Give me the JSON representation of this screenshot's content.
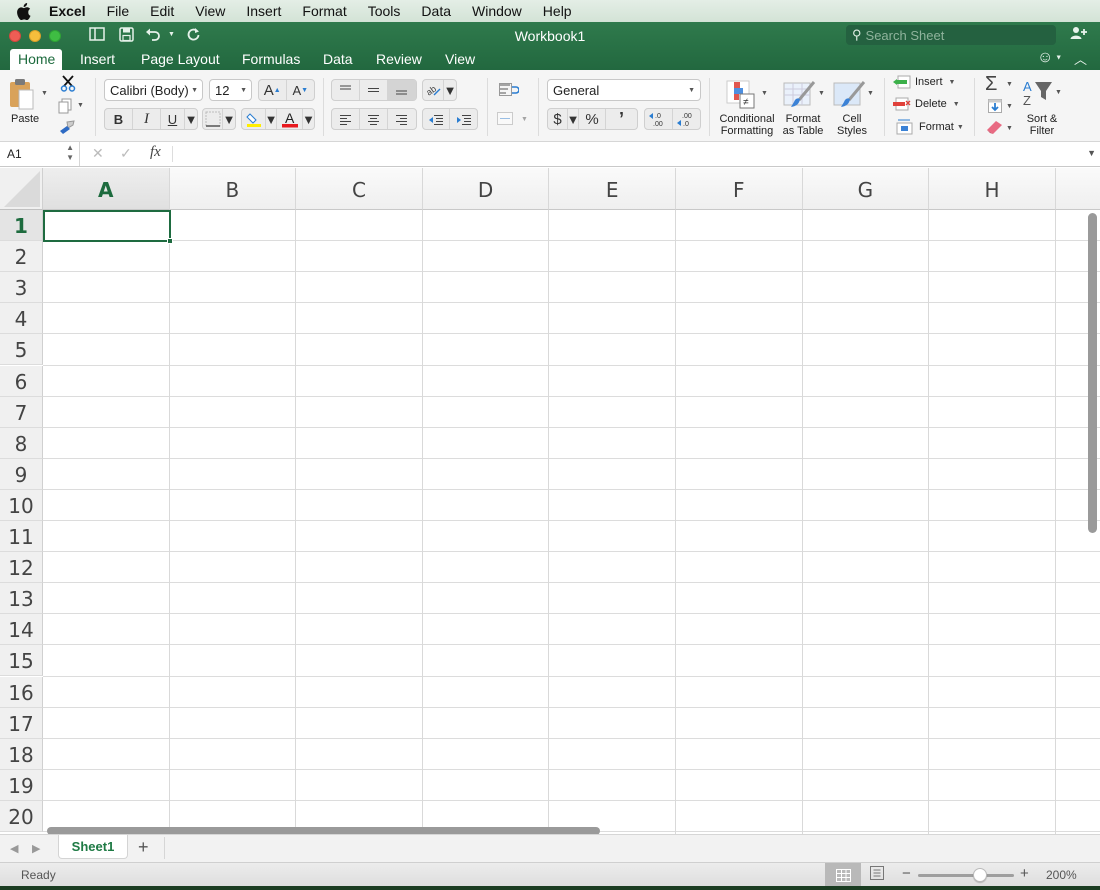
{
  "menubar": {
    "app_name": "Excel",
    "items": [
      "File",
      "Edit",
      "View",
      "Insert",
      "Format",
      "Tools",
      "Data",
      "Window",
      "Help"
    ]
  },
  "titlebar": {
    "title": "Workbook1",
    "search_placeholder": "Search Sheet"
  },
  "ribbon_tabs": [
    "Home",
    "Insert",
    "Page Layout",
    "Formulas",
    "Data",
    "Review",
    "View"
  ],
  "active_tab": "Home",
  "ribbon": {
    "paste_label": "Paste",
    "font_name": "Calibri (Body)",
    "font_size": "12",
    "grow_font": "A",
    "shrink_font": "A",
    "bold": "B",
    "italic": "I",
    "underline": "U",
    "number_format": "General",
    "currency": "$",
    "percent": "%",
    "comma": "’",
    "inc_decimal": ".0",
    "dec_decimal": ".00",
    "conditional_formatting": [
      "Conditional",
      "Formatting"
    ],
    "format_as_table": [
      "Format",
      "as Table"
    ],
    "cell_styles": [
      "Cell",
      "Styles"
    ],
    "insert": "Insert",
    "delete": "Delete",
    "format": "Format",
    "sort_filter": [
      "Sort &",
      "Filter"
    ],
    "fill_color": "#ffee00",
    "font_color": "#e8191e"
  },
  "formula_bar": {
    "name_box": "A1",
    "fx": "fx",
    "value": ""
  },
  "grid": {
    "columns": [
      "A",
      "B",
      "C",
      "D",
      "E",
      "F",
      "G",
      "H"
    ],
    "rows": [
      "1",
      "2",
      "3",
      "4",
      "5",
      "6",
      "7",
      "8",
      "9",
      "10",
      "11",
      "12",
      "13",
      "14",
      "15",
      "16",
      "17",
      "18",
      "19",
      "20"
    ],
    "selected_cell": "A1"
  },
  "sheets": [
    "Sheet1"
  ],
  "active_sheet": "Sheet1",
  "status": {
    "text": "Ready",
    "zoom": "200%"
  },
  "colors": {
    "accent": "#217346",
    "title_bar": "#2a7347"
  }
}
